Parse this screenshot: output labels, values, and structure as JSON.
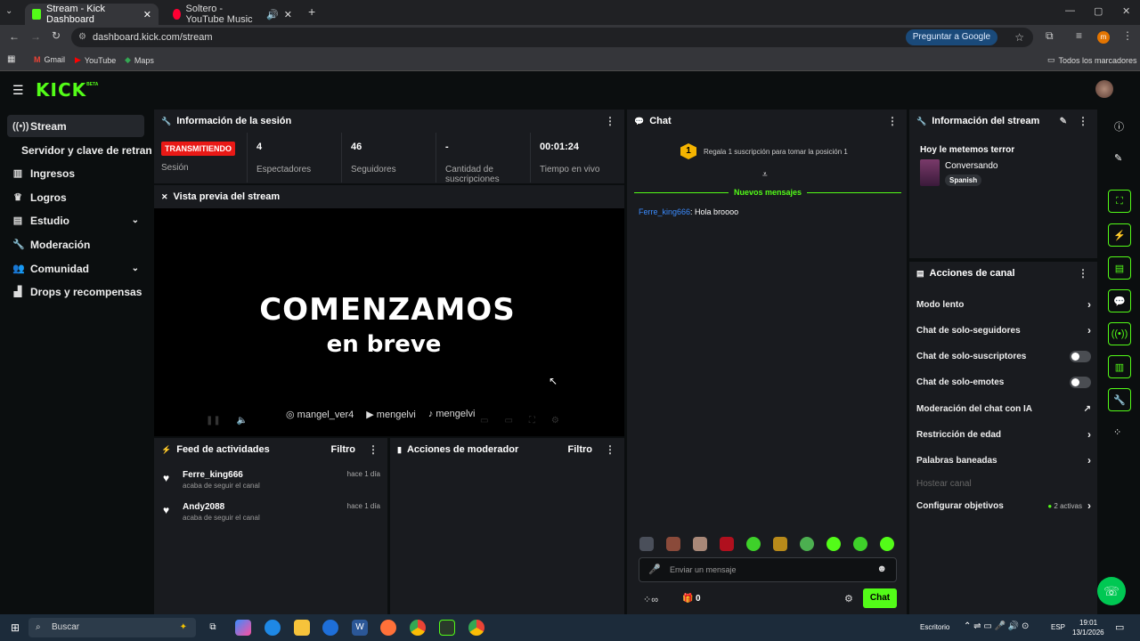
{
  "browser": {
    "tabs": [
      {
        "title": "Stream - Kick Dashboard",
        "active": true
      },
      {
        "title": "Soltero - YouTube Music",
        "active": false
      }
    ],
    "url": "dashboard.kick.com/stream",
    "ask_google": "Preguntar a Google",
    "bookmarks": [
      "Gmail",
      "YouTube",
      "Maps"
    ],
    "all_bookmarks": "Todos los marcadores"
  },
  "app": {
    "logo": "KICK",
    "logo_badge": "BETA",
    "accent": "#53fc18"
  },
  "sidebar": {
    "items": [
      {
        "label": "Stream",
        "icon": "broadcast-icon"
      },
      {
        "label": "Servidor y clave de retransmisión"
      },
      {
        "label": "Ingresos",
        "icon": "money-icon"
      },
      {
        "label": "Logros",
        "icon": "trophy-icon"
      },
      {
        "label": "Estudio",
        "icon": "studio-icon"
      },
      {
        "label": "Moderación",
        "icon": "wrench-icon"
      },
      {
        "label": "Comunidad",
        "icon": "people-icon"
      },
      {
        "label": "Drops y recompensas",
        "icon": "gift-icon"
      }
    ]
  },
  "session": {
    "title": "Información de la sesión",
    "status": "TRANSMITIENDO",
    "status_label": "Sesión",
    "stats": [
      {
        "value": "4",
        "label": "Espectadores"
      },
      {
        "value": "46",
        "label": "Seguidores"
      },
      {
        "value": "-",
        "label": "Cantidad de suscripciones"
      },
      {
        "value": "00:01:24",
        "label": "Tiempo en vivo"
      }
    ]
  },
  "preview": {
    "title": "Vista previa del stream",
    "headline": "COMENZAMOS",
    "subline": "en breve",
    "socials": [
      "mangel_ver4",
      "mengelvi",
      "mengelvi"
    ]
  },
  "feed": {
    "title": "Feed de actividades",
    "filter": "Filtro",
    "items": [
      {
        "user": "Ferre_king666",
        "action": "acaba de seguir el canal",
        "time": "hace 1 día"
      },
      {
        "user": "Andy2088",
        "action": "acaba de seguir el canal",
        "time": "hace 1 día"
      }
    ]
  },
  "mod_actions": {
    "title": "Acciones de moderador",
    "filter": "Filtro"
  },
  "chat": {
    "title": "Chat",
    "gift_rank": "1",
    "gift_text": "Regala 1 suscripción para tomar la posición 1",
    "new_messages": "Nuevos mensajes",
    "messages": [
      {
        "user": "Ferre_king666",
        "text": ": Hola broooo"
      }
    ],
    "input_placeholder": "Enviar un mensaje",
    "points": "0",
    "send": "Chat"
  },
  "stream_info": {
    "title": "Información del stream",
    "stream_title": "Hoy le metemos terror",
    "category": "Conversando",
    "language": "Spanish"
  },
  "channel_actions": {
    "title": "Acciones de canal",
    "items": [
      {
        "label": "Modo lento",
        "control": "arrow"
      },
      {
        "label": "Chat de solo-seguidores",
        "control": "arrow"
      },
      {
        "label": "Chat de solo-suscriptores",
        "control": "toggle"
      },
      {
        "label": "Chat de solo-emotes",
        "control": "toggle"
      },
      {
        "label": "Moderación del chat con IA",
        "control": "external"
      },
      {
        "label": "Restricción de edad",
        "control": "arrow"
      },
      {
        "label": "Palabras baneadas",
        "control": "arrow"
      },
      {
        "label": "Hostear canal",
        "control": "none"
      },
      {
        "label": "Configurar objetivos",
        "control": "arrow"
      }
    ],
    "goals_active": "2 activas"
  },
  "taskbar": {
    "search": "Buscar",
    "desktop": "Escritorio",
    "lang": "ESP",
    "time": "19:01",
    "date": "13/1/2026"
  }
}
